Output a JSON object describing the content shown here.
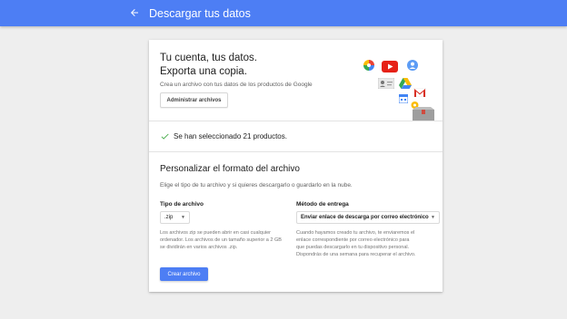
{
  "appbar": {
    "title": "Descargar tus datos",
    "back_icon": "arrow-back-icon",
    "color": "#4d7ef4"
  },
  "intro": {
    "headline_line1": "Tu cuenta, tus datos.",
    "headline_line2": "Exporta una copia.",
    "subtext": "Crea un archivo con tus datos de los productos de Google",
    "manage_button": "Administrar archivos"
  },
  "selection": {
    "status": "Se han seleccionado 21 productos.",
    "icon": "check-icon",
    "check_color": "#4caf50"
  },
  "format": {
    "title": "Personalizar el formato del archivo",
    "description": "Elige el tipo de tu archivo y si quieres descargarlo o guardarlo en la nube.",
    "file_type": {
      "label": "Tipo de archivo",
      "value": ".zip",
      "help_line1": "Los archivos zip se pueden abrir en casi cualquier",
      "help_line2": "ordenador. Los archivos de un tamaño superior a 2 GB",
      "help_line3": "se dividirán en varios archivos .zip."
    },
    "delivery": {
      "label": "Método de entrega",
      "value": "Enviar enlace de descarga por correo electrónico",
      "help_line1": "Cuando hayamos creado tu archivo, te enviaremos el",
      "help_line2": "enlace correspondiente por correo electrónico para",
      "help_line3": "que puedas descargarlo en tu dispositivo personal.",
      "help_line4": "Dispondrás de una semana para recuperar el archivo."
    },
    "create_button": "Crear archivo"
  },
  "illustration_icons": [
    "photos-icon",
    "youtube-icon",
    "profile-icon",
    "contacts-icon",
    "drive-icon",
    "gmail-icon",
    "calendar-icon",
    "maps-icon",
    "box-icon"
  ]
}
